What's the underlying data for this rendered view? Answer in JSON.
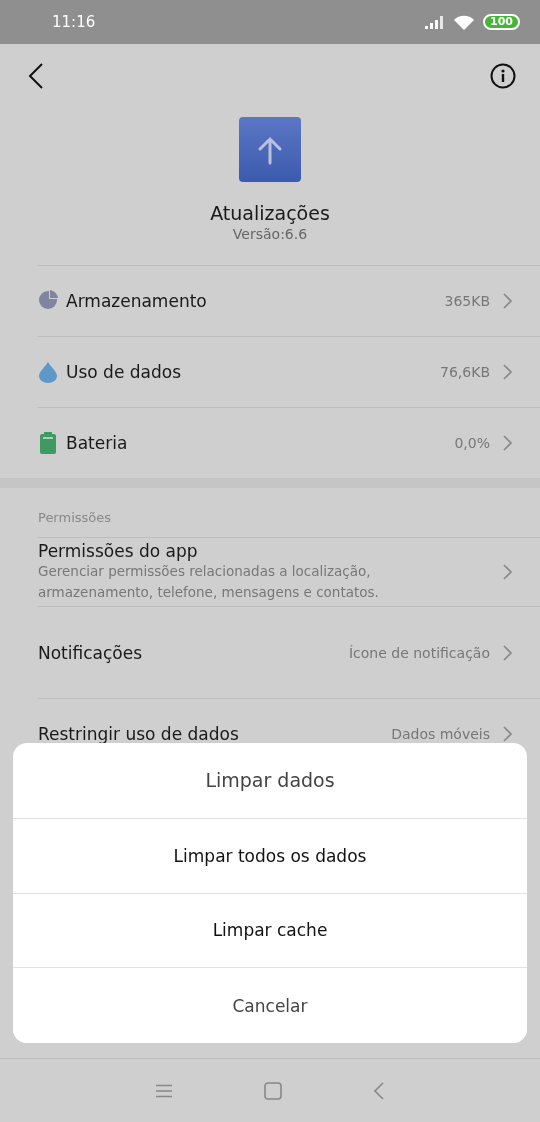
{
  "status_bar": {
    "time": "11:16",
    "battery": "100"
  },
  "app": {
    "name": "Atualizações",
    "version": "Versão:6.6"
  },
  "usage_rows": [
    {
      "kind": "storage",
      "label": "Armazenamento",
      "value": "365KB"
    },
    {
      "kind": "data",
      "label": "Uso de dados",
      "value": "76,6KB"
    },
    {
      "kind": "battery",
      "label": "Bateria",
      "value": "0,0%"
    }
  ],
  "permissions": {
    "header": "Permissões",
    "rows": [
      {
        "label": "Permissões do app",
        "subtitle": "Gerenciar permissões relacionadas a localização, armazenamento, telefone, mensagens e contatos."
      },
      {
        "label": "Notificações",
        "value": "Ícone de notificação"
      },
      {
        "label": "Restringir uso de dados",
        "value": "Dados móveis"
      }
    ]
  },
  "dialog": {
    "title": "Limpar dados",
    "options": [
      "Limpar todos os dados",
      "Limpar cache"
    ],
    "cancel": "Cancelar"
  }
}
